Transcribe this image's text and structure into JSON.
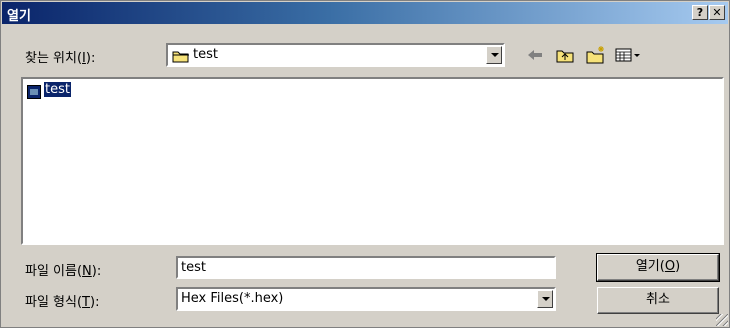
{
  "window": {
    "title": "열기",
    "help_label": "?",
    "close_label": "✕"
  },
  "lookin": {
    "label_prefix": "찾는 위치(",
    "label_key": "I",
    "label_suffix": "):",
    "value": "test"
  },
  "toolbar": [
    {
      "name": "back-icon"
    },
    {
      "name": "up-folder-icon"
    },
    {
      "name": "new-folder-icon"
    },
    {
      "name": "view-menu-icon"
    }
  ],
  "files": [
    {
      "name": "test",
      "icon": "document-icon",
      "selected": true
    }
  ],
  "filename": {
    "label_prefix": "파일 이름(",
    "label_key": "N",
    "label_suffix": "):",
    "value": "test"
  },
  "filetype": {
    "label_prefix": "파일 형식(",
    "label_key": "T",
    "label_suffix": "):",
    "value": "Hex Files(*.hex)"
  },
  "buttons": {
    "open": {
      "prefix": "열기(",
      "key": "O",
      "suffix": ")"
    },
    "cancel": "취소"
  },
  "colors": {
    "title_start": "#0a246a",
    "title_end": "#a6caf0",
    "face": "#d4d0c8",
    "selection": "#0a246a"
  }
}
